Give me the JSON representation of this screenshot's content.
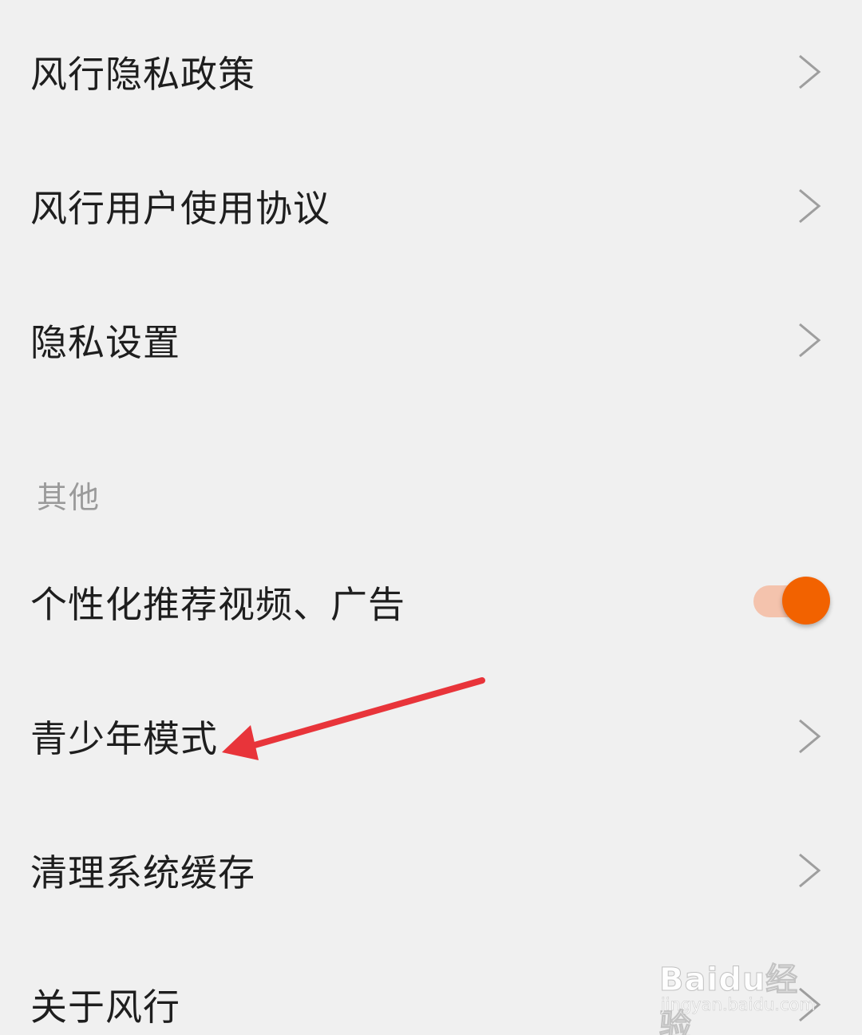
{
  "settings": {
    "items_top": [
      {
        "label": "风行隐私政策"
      },
      {
        "label": "风行用户使用协议"
      },
      {
        "label": "隐私设置"
      }
    ],
    "section_other": {
      "title": "其他",
      "personalized": {
        "label": "个性化推荐视频、广告",
        "enabled": true
      },
      "items": [
        {
          "label": "青少年模式"
        },
        {
          "label": "清理系统缓存"
        },
        {
          "label": "关于风行"
        }
      ]
    }
  },
  "colors": {
    "background": "#f0f0f0",
    "text": "#1e1e1e",
    "section_text": "#9a9a9a",
    "chevron": "#9e9e9e",
    "toggle_on": "#f26200",
    "toggle_track": "#f4c3ad",
    "annotation_arrow": "#e8343a"
  },
  "watermark": {
    "brand": "Baidu经验",
    "url": "jingyan.baidu.com"
  }
}
